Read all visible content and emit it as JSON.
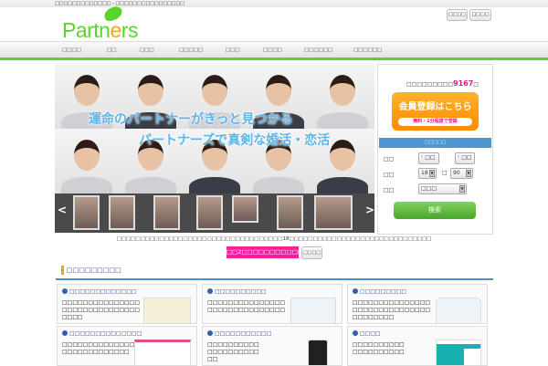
{
  "topbar": {
    "tagline": "□□□□□□□□□□□□□ - □□□□□□□□□□□□□□□□"
  },
  "header": {
    "logo": "Partners",
    "buttons": [
      "□□□□",
      "□□□□"
    ]
  },
  "nav": [
    "□□□□",
    "□□",
    "□□□",
    "□□□□□",
    "□□□",
    "□□□□",
    "□□□□□□",
    "□□□□□□"
  ],
  "hero": {
    "copy1": "運命のパートナーがきっと見つかる",
    "copy2": "パートナーズで真剣な婚活・恋活",
    "prev": "<",
    "next": ">"
  },
  "side": {
    "count_prefix": "□□□□□□□□□",
    "count": "9167",
    "count_suffix": "□",
    "register": "会員登録はこちら",
    "register_sub": "無料・1分程度で登録",
    "search_head": "□□□□□",
    "gender_label": "□□",
    "gender_options": [
      "□□",
      "□□"
    ],
    "age_label": "□□",
    "age_from": "18",
    "age_sep": "□",
    "age_to": "90",
    "area_label": "□□",
    "area_value": "□□□",
    "search_button": "検索"
  },
  "notice": "□□□□□□□□□□□□□□□□□□□□□□□□□□□□□□□□□□□18□□□□□□□□□□□□□□□□□□□□□□□□□□□□□□",
  "promo": {
    "pink": "□□2□□□□□□□□□□□",
    "more": "□□□□"
  },
  "section": {
    "title": "□□□□□□□□□"
  },
  "cards": [
    {
      "title": "□□□□□□□□□□□□□",
      "desc": "□□□□□□□□□□□□□□□□□□□□□□□□□□□□□□□□□□"
    },
    {
      "title": "□□□□□□□□□□",
      "desc": "□□□□□□□□□□□□□□□□□□□□□□□□□□□□□□"
    },
    {
      "title": "□□□□□□□□□",
      "desc": "□□□□□□□□□□□□□□□□□□□□□□□□□□□□□□□□□□□□□□"
    },
    {
      "title": "□□□□□□□□□□□□□□",
      "desc": "□□□□□□□□□□□□□□□□□□□□□□□□□□□"
    },
    {
      "title": "□□□□□□□□□□□",
      "desc": "□□□□□□□□□□□□□□□□□□□□□□"
    },
    {
      "title": "□□□□",
      "desc": "□□□□□□□□□□□□□□□□□□□□"
    }
  ]
}
